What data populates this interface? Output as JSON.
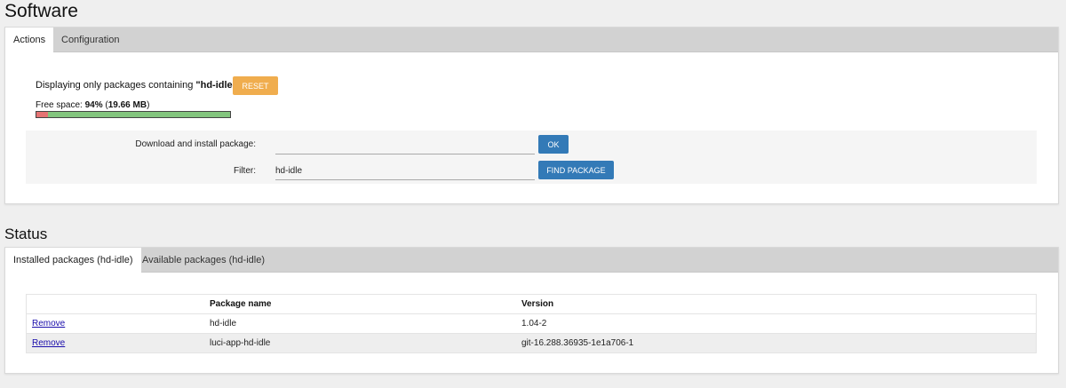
{
  "page_title": "Software",
  "actions_panel": {
    "tabs": [
      {
        "label": "Actions",
        "active": true
      },
      {
        "label": "Configuration",
        "active": false
      }
    ],
    "filter_info": {
      "prefix": "Displaying only packages containing ",
      "term": "\"hd-idle\""
    },
    "reset_label": "RESET",
    "free_space": {
      "label": "Free space: ",
      "percent": "94%",
      "size_open": " (",
      "size": "19.66 MB",
      "size_close": ")",
      "used_fraction": 0.06
    },
    "download_label": "Download and install package:",
    "download_value": "",
    "ok_label": "OK",
    "filter_label": "Filter:",
    "filter_value": "hd-idle",
    "find_label": "FIND PACKAGE"
  },
  "status_title": "Status",
  "status_panel": {
    "tabs": [
      {
        "label": "Installed packages (hd-idle)",
        "active": true
      },
      {
        "label": "Available packages (hd-idle)",
        "active": false
      }
    ],
    "columns": [
      "",
      "Package name",
      "Version"
    ],
    "rows": [
      {
        "action": "Remove",
        "name": "hd-idle",
        "version": "1.04-2"
      },
      {
        "action": "Remove",
        "name": "luci-app-hd-idle",
        "version": "git-16.288.36935-1e1a706-1"
      }
    ]
  },
  "colors": {
    "reset_button": "#f0ad4e",
    "primary_button": "#337ab7",
    "bar_free": "#83c57e",
    "bar_used": "#e57373"
  }
}
